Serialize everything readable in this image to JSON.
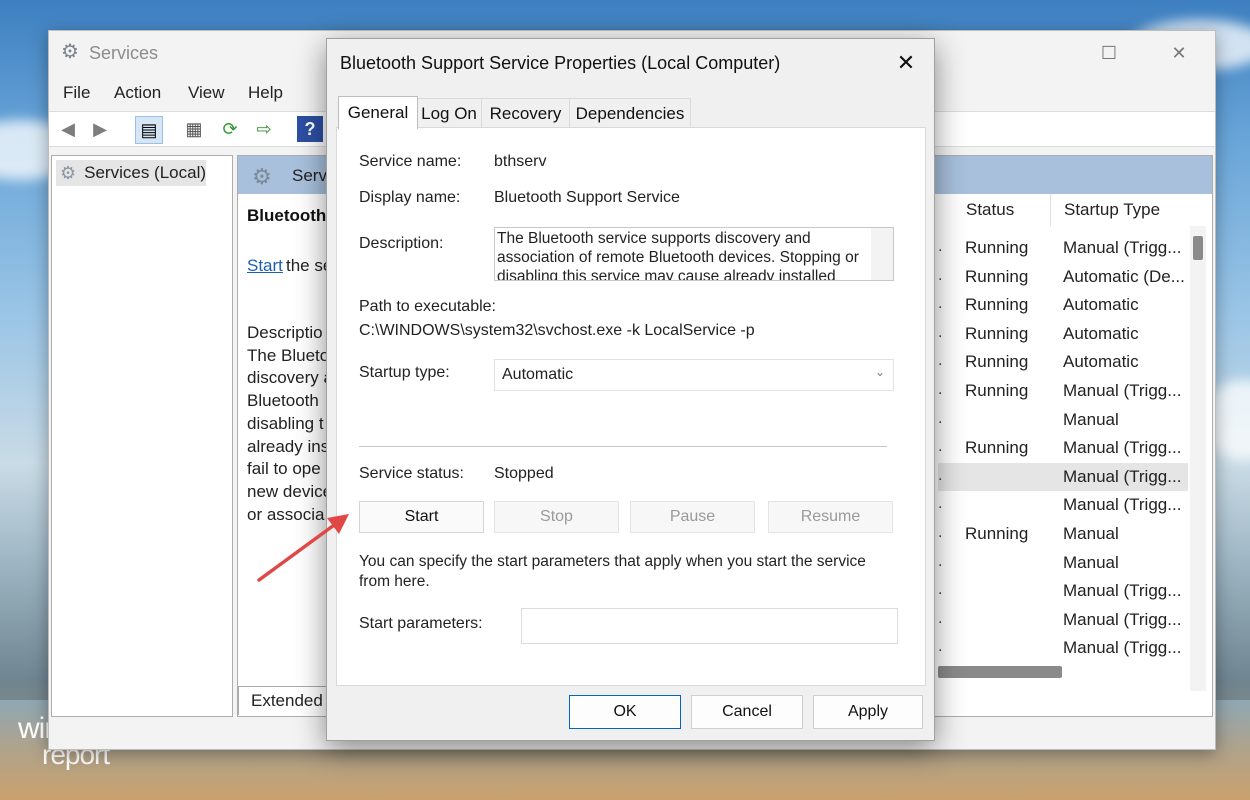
{
  "desktop": {
    "logo_line1": "windows",
    "logo_line2": "report"
  },
  "services_window": {
    "title": "Services",
    "menu": [
      "File",
      "Action",
      "View",
      "Help"
    ],
    "tree_item": "Services (Local)",
    "header_text": "Servi",
    "selected_name": "Bluetooth",
    "start_link": "Start",
    "start_rest": "the se",
    "description_lines": [
      "Descriptio",
      "The Blueto",
      "discovery a",
      "Bluetooth",
      "disabling t",
      "already ins",
      "fail to ope",
      "new device",
      "or associa"
    ],
    "extended_tab": "Extended",
    "columns": {
      "status": "Status",
      "startup_type": "Startup Type"
    },
    "rows": [
      {
        "status": "Running",
        "startup": "Manual (Trigg..."
      },
      {
        "status": "Running",
        "startup": "Automatic (De..."
      },
      {
        "status": "Running",
        "startup": "Automatic"
      },
      {
        "status": "Running",
        "startup": "Automatic"
      },
      {
        "status": "Running",
        "startup": "Automatic"
      },
      {
        "status": "Running",
        "startup": "Manual (Trigg..."
      },
      {
        "status": "",
        "startup": "Manual"
      },
      {
        "status": "Running",
        "startup": "Manual (Trigg..."
      },
      {
        "status": "",
        "startup": "Manual (Trigg..."
      },
      {
        "status": "",
        "startup": "Manual (Trigg..."
      },
      {
        "status": "Running",
        "startup": "Manual"
      },
      {
        "status": "",
        "startup": "Manual"
      },
      {
        "status": "",
        "startup": "Manual (Trigg..."
      },
      {
        "status": "",
        "startup": "Manual (Trigg..."
      },
      {
        "status": "",
        "startup": "Manual (Trigg..."
      }
    ]
  },
  "dialog": {
    "title": "Bluetooth Support Service Properties (Local Computer)",
    "tabs": [
      "General",
      "Log On",
      "Recovery",
      "Dependencies"
    ],
    "service_name_label": "Service name:",
    "service_name": "bthserv",
    "display_name_label": "Display name:",
    "display_name": "Bluetooth Support Service",
    "description_label": "Description:",
    "description": "The Bluetooth service supports discovery and association of remote Bluetooth devices.  Stopping or disabling this service may cause already installed",
    "path_label": "Path to executable:",
    "path": "C:\\WINDOWS\\system32\\svchost.exe -k LocalService -p",
    "startup_type_label": "Startup type:",
    "startup_type_value": "Automatic",
    "service_status_label": "Service status:",
    "service_status": "Stopped",
    "buttons": {
      "start": "Start",
      "stop": "Stop",
      "pause": "Pause",
      "resume": "Resume"
    },
    "note": "You can specify the start parameters that apply when you start the service from here.",
    "start_params_label": "Start parameters:",
    "start_params_value": "",
    "footer": {
      "ok": "OK",
      "cancel": "Cancel",
      "apply": "Apply"
    }
  },
  "colors": {
    "accent": "#0067c0",
    "link": "#1a5fb4",
    "arrow": "#e04848",
    "header_band": "#a8c0dc"
  }
}
